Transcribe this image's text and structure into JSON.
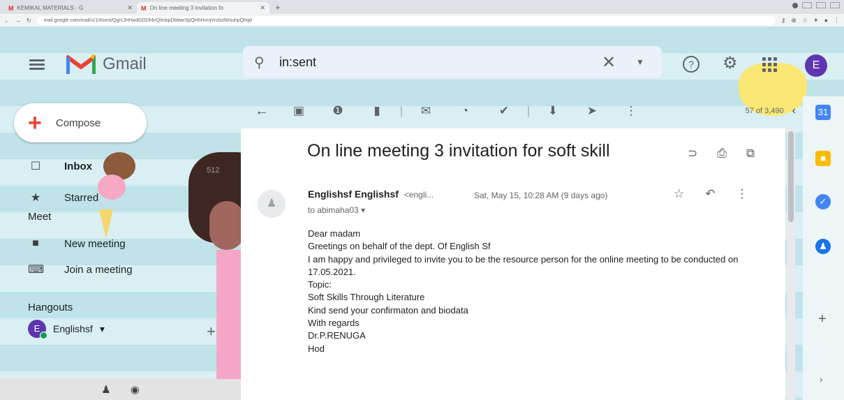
{
  "browser": {
    "tabs": [
      {
        "title": "KEMIKAL MATERIALS - G",
        "favicon": "M"
      },
      {
        "title": "On line meeting 3 invitation fo",
        "favicon": "M"
      }
    ],
    "new_tab": "+",
    "url": "mail.google.com/mail/u/1/#sent/QgrcJHrtwdGDDhbrQlmbpDbbwrSpQHhHvrqVrsfzdWsuhpQhqd"
  },
  "header": {
    "app_name": "Gmail",
    "search_query": "in:sent",
    "avatar_letter": "E",
    "help": "?"
  },
  "sidebar": {
    "compose_label": "Compose",
    "items": [
      {
        "label": "Inbox",
        "icon": "inbox-icon",
        "glyph": "☐",
        "count": "512"
      },
      {
        "label": "Starred",
        "icon": "star-icon",
        "glyph": "★"
      }
    ],
    "meet_title": "Meet",
    "meet_items": [
      {
        "label": "New meeting",
        "icon": "video-icon",
        "glyph": "■"
      },
      {
        "label": "Join a meeting",
        "icon": "keyboard-icon",
        "glyph": "⌨"
      }
    ],
    "hangouts_title": "Hangouts",
    "hangouts_user": "Englishsf",
    "hangouts_user_initial": "E",
    "hangouts_caret": "▾"
  },
  "toolbar": {
    "pager": "57 of 3,490"
  },
  "message": {
    "subject": "On line meeting 3 invitation for soft skill",
    "sender_name": "Englishsf Englishsf",
    "sender_addr": "<engli...",
    "date": "Sat, May 15, 10:28 AM (9 days ago)",
    "to": "to abimaha03",
    "body": [
      "Dear madam",
      "Greetings on behalf of the dept. Of English Sf",
      "I am happy and privileged to invite you to be the resource person for the online meeting to be conducted  on 17.05.2021.",
      "Topic:",
      "Soft Skills Through Literature",
      "Kind send your confirmaton and biodata",
      "With regards",
      "Dr.P.RENUGA",
      "Hod"
    ]
  },
  "colors": {
    "accent": "#5e35b1",
    "gmail_red": "#ea4335",
    "background_stripe": "#bfe3e9"
  }
}
